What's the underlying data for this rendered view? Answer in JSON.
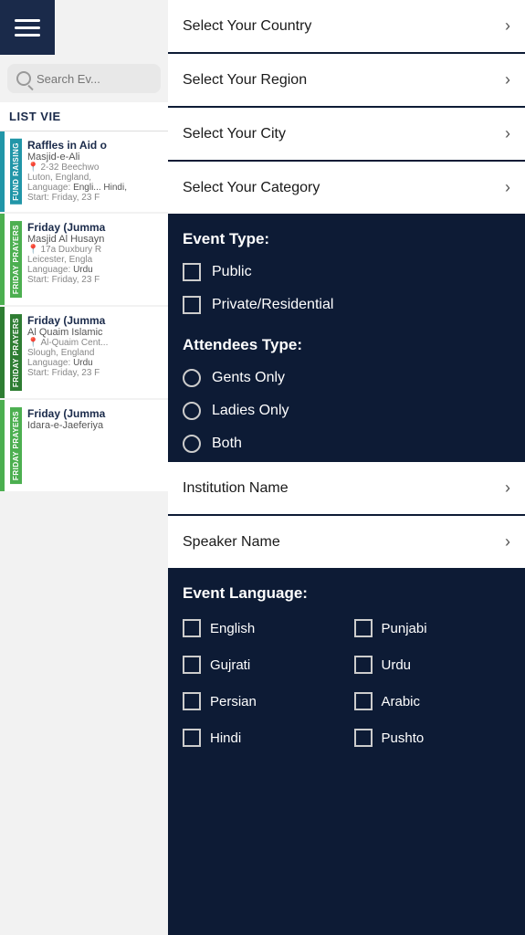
{
  "leftPanel": {
    "searchPlaceholder": "Search Ev...",
    "listViewLabel": "LIST VIE",
    "events": [
      {
        "id": 1,
        "sideLabel": "FUND RAISING",
        "color": "blue",
        "title": "Raffles in Aid o",
        "venue": "Masjid-e-Ali",
        "address": "2-32 Beechwo",
        "city": "Luton, England,",
        "language": "Engli... Hindi,",
        "date": "Start: Friday, 23 F"
      },
      {
        "id": 2,
        "sideLabel": "FRIDAY PRAYERS",
        "color": "green",
        "title": "Friday (Jumma",
        "venue": "Masjid Al Husayn",
        "address": "17a Duxbury R",
        "city": "Leicester, Engla",
        "language": "Urdu",
        "date": "Start: Friday, 23 F"
      },
      {
        "id": 3,
        "sideLabel": "FRIDAY PRAYERS",
        "color": "dark-green",
        "title": "Friday (Jumma",
        "venue": "Al Quaim Islamic",
        "address": "Al-Quaim Cent...",
        "city": "Slough, England",
        "language": "Urdu",
        "date": "Start: Friday, 23 F"
      },
      {
        "id": 4,
        "sideLabel": "FRIDAY PRAYERS",
        "color": "green",
        "title": "Friday (Jumma",
        "venue": "Idara-e-Jaeferiya",
        "address": "",
        "city": "",
        "language": "",
        "date": ""
      }
    ]
  },
  "rightPanel": {
    "filters": [
      {
        "id": "country",
        "label": "Select Your Country"
      },
      {
        "id": "region",
        "label": "Select Your Region"
      },
      {
        "id": "city",
        "label": "Select Your City"
      },
      {
        "id": "category",
        "label": "Select Your Category"
      }
    ],
    "eventTypeSection": "Event Type:",
    "eventTypes": [
      {
        "id": "public",
        "label": "Public"
      },
      {
        "id": "private",
        "label": "Private/Residential"
      }
    ],
    "attendeesSection": "Attendees Type:",
    "attendeesTypes": [
      {
        "id": "gents",
        "label": "Gents Only"
      },
      {
        "id": "ladies",
        "label": "Ladies Only"
      },
      {
        "id": "both",
        "label": "Both"
      }
    ],
    "institutionFilter": "Institution Name",
    "speakerFilter": "Speaker Name",
    "languageSection": "Event Language:",
    "languages": [
      {
        "id": "english",
        "label": "English"
      },
      {
        "id": "punjabi",
        "label": "Punjabi"
      },
      {
        "id": "gujrati",
        "label": "Gujrati"
      },
      {
        "id": "urdu",
        "label": "Urdu"
      },
      {
        "id": "persian",
        "label": "Persian"
      },
      {
        "id": "arabic",
        "label": "Arabic"
      },
      {
        "id": "hindi",
        "label": "Hindi"
      },
      {
        "id": "pushto",
        "label": "Pushto"
      }
    ]
  }
}
